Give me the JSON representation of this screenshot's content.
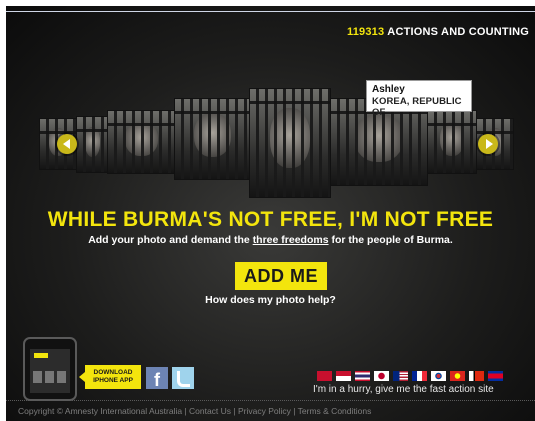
{
  "counter": {
    "number": "119313",
    "label": "ACTIONS AND COUNTING"
  },
  "tooltip": {
    "name": "Ashley",
    "country": "KOREA, REPUBLIC OF"
  },
  "headline": "WHILE BURMA'S NOT FREE, I'M NOT FREE",
  "subline": {
    "before": "Add your photo and demand the ",
    "link": "three freedoms",
    "after": " for the people of Burma."
  },
  "add_button": "ADD ME",
  "help_link": "How does my photo help?",
  "app": {
    "download_line1": "DOWNLOAD",
    "download_line2": "IPHONE APP"
  },
  "social": {
    "facebook": "f"
  },
  "fast_action": "I'm in a hurry, give me the fast action site",
  "footer": "Copyright © Amnesty International Australia | Contact Us | Privacy Policy | Terms & Conditions",
  "colors": {
    "accent": "#f3e50d",
    "background": "#1d1d1c"
  },
  "icons": [
    "arrow-left-icon",
    "arrow-right-icon",
    "iphone-icon",
    "facebook-icon",
    "twitter-icon",
    "flag-icon"
  ]
}
